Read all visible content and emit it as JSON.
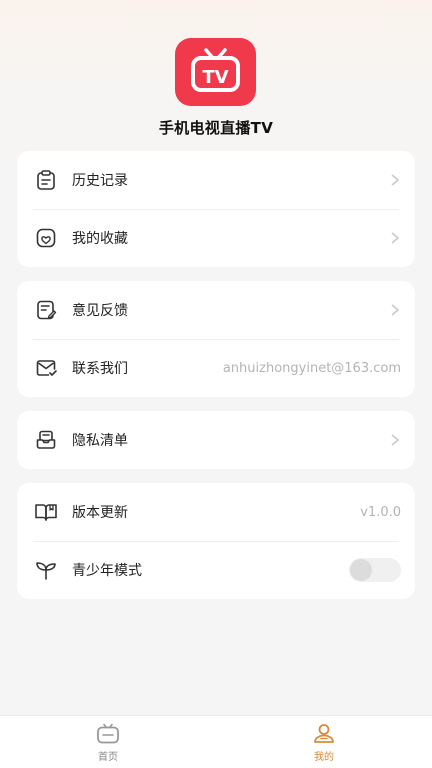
{
  "app": {
    "name": "手机电视直播TV",
    "logo_text": "TV",
    "logo_color": "#f03a4b"
  },
  "groups": [
    {
      "items": [
        {
          "label": "历史记录",
          "icon": "clipboard-icon"
        },
        {
          "label": "我的收藏",
          "icon": "favorites-icon"
        }
      ]
    },
    {
      "items": [
        {
          "label": "意见反馈",
          "icon": "feedback-icon"
        },
        {
          "label": "联系我们",
          "icon": "mail-icon",
          "value": "anhuizhongyinet@163.com"
        }
      ]
    },
    {
      "items": [
        {
          "label": "隐私清单",
          "icon": "inbox-icon"
        }
      ]
    },
    {
      "items": [
        {
          "label": "版本更新",
          "icon": "book-icon",
          "value": "v1.0.0"
        },
        {
          "label": "青少年模式",
          "icon": "sprout-icon",
          "toggle_on": false
        }
      ]
    }
  ],
  "tabbar": {
    "tabs": [
      {
        "label": "首页",
        "icon": "tv-icon",
        "active": false
      },
      {
        "label": "我的",
        "icon": "user-icon",
        "active": true
      }
    ],
    "active_color": "#d98a3a"
  }
}
